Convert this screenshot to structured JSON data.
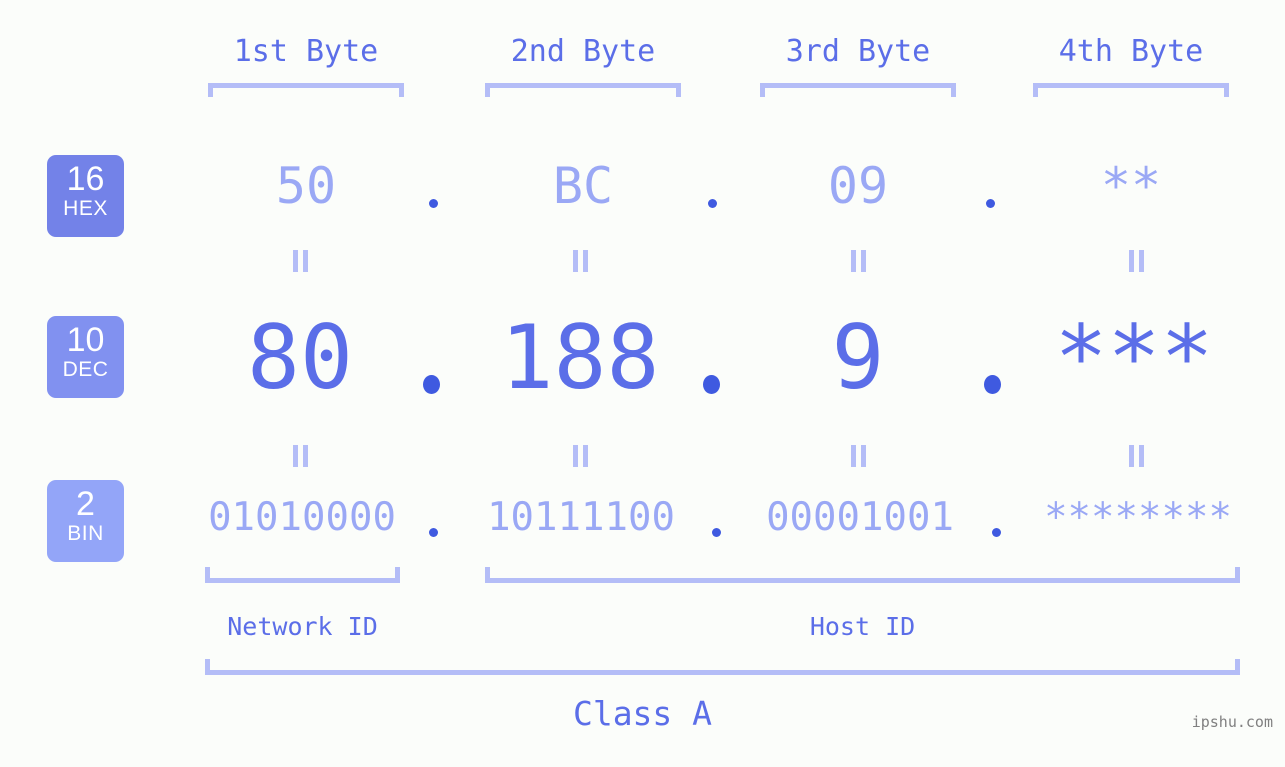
{
  "meta": {
    "background_color": "#fbfdfa",
    "accent_color": "#5b6ee8",
    "light_accent_color": "#9aa8f5",
    "bracket_color": "#b4bdf7",
    "dot_color": "#3f5ae0",
    "watermark_color": "#808080"
  },
  "watermark": "ipshu.com",
  "byte_headers": [
    {
      "label": "1st Byte"
    },
    {
      "label": "2nd Byte"
    },
    {
      "label": "3rd Byte"
    },
    {
      "label": "4th Byte"
    }
  ],
  "bases": [
    {
      "number": "16",
      "name": "HEX",
      "color": "#7382e8"
    },
    {
      "number": "10",
      "name": "DEC",
      "color": "#8191f0"
    },
    {
      "number": "2",
      "name": "BIN",
      "color": "#93a5f8"
    }
  ],
  "rows": {
    "hex": {
      "base_number": "16",
      "base_name": "HEX",
      "octets": [
        "50",
        "BC",
        "09",
        "**"
      ],
      "separator": "."
    },
    "dec": {
      "base_number": "10",
      "base_name": "DEC",
      "octets": [
        "80",
        "188",
        "9",
        "***"
      ],
      "separator": "."
    },
    "bin": {
      "base_number": "2",
      "base_name": "BIN",
      "octets": [
        "01010000",
        "10111100",
        "00001001",
        "********"
      ],
      "separator": "."
    }
  },
  "equals_marks": {
    "glyph": "||",
    "count_per_row_gap": 4,
    "gaps": 2
  },
  "segments": {
    "network_id": {
      "label": "Network ID"
    },
    "host_id": {
      "label": "Host ID"
    },
    "class": {
      "label": "Class A"
    }
  }
}
